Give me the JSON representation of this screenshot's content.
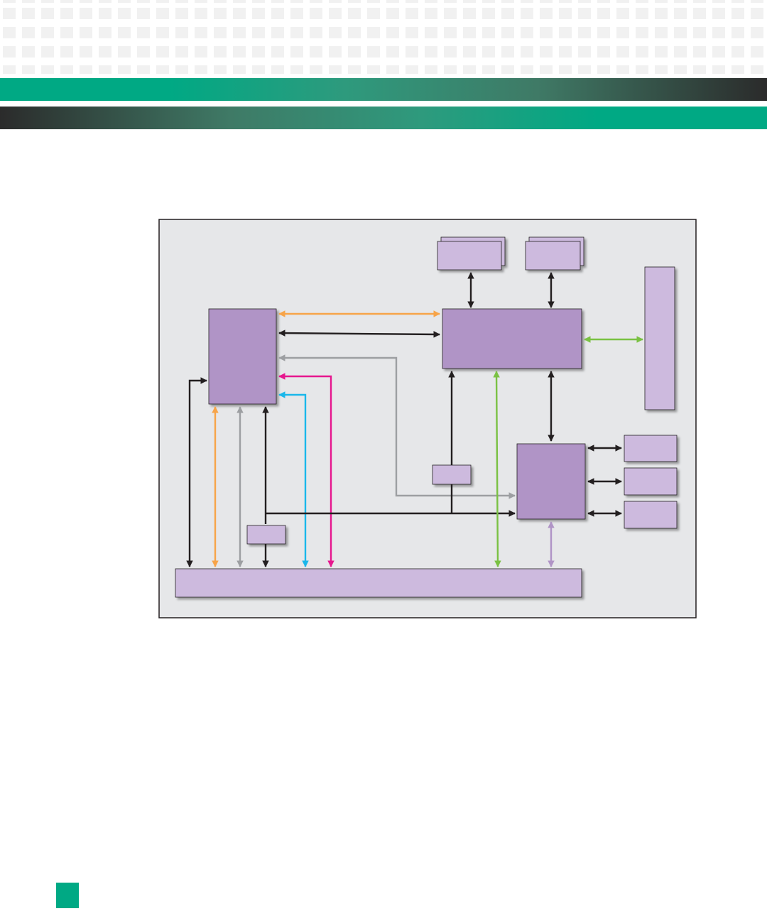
{
  "header": {
    "pattern": "grey-square-grid",
    "band_colors": {
      "accent": "#00a984",
      "dark": "#2b2b2b"
    }
  },
  "diagram": {
    "colors": {
      "panel_fill": "#e6e7e9",
      "panel_border": "#231f20",
      "block_dark": "#b094c6",
      "block_light": "#cdbade",
      "black_link": "#231f20",
      "orange_link": "#f7a449",
      "grey_link": "#9d9fa2",
      "magenta_link": "#e6178e",
      "cyan_link": "#1ab7ea",
      "green_link": "#7ac143",
      "lilac_link": "#b094c6"
    }
  },
  "footer": {
    "marker_color": "#00a984"
  }
}
